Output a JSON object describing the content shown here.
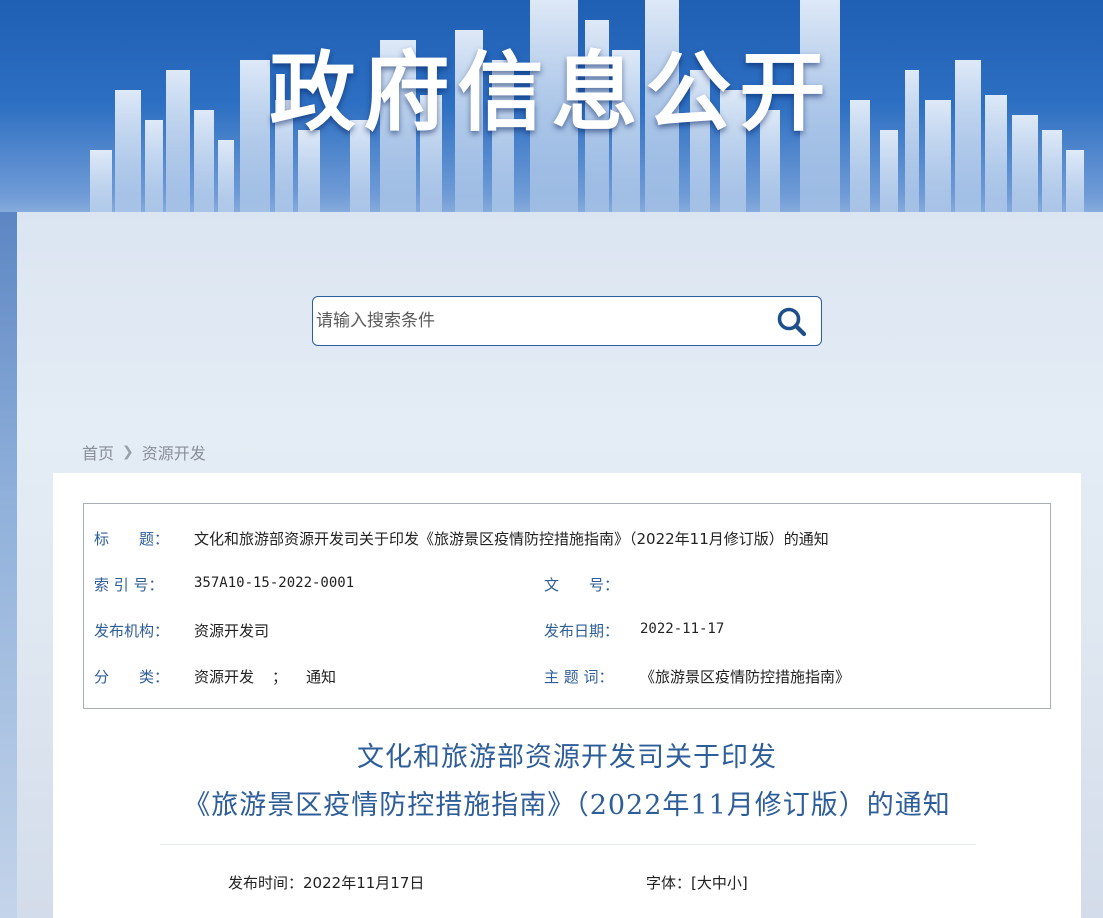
{
  "banner": {
    "title": "政府信息公开"
  },
  "search": {
    "placeholder": "请输入搜索条件",
    "button_icon": "search-icon"
  },
  "breadcrumb": {
    "home": "首页",
    "current": "资源开发"
  },
  "meta": {
    "title_label": "标　　题：",
    "title_value": "文化和旅游部资源开发司关于印发《旅游景区疫情防控措施指南》（2022年11月修订版）的通知",
    "index_label": "索 引 号：",
    "index_value": "357A10-15-2022-0001",
    "doc_no_label": "文　　号：",
    "doc_no_value": "",
    "publisher_label": "发布机构：",
    "publisher_value": "资源开发司",
    "pub_date_label": "发布日期：",
    "pub_date_value": "2022-11-17",
    "category_label": "分　　类：",
    "category_value_1": "资源开发",
    "category_sep": "；",
    "category_value_2": "通知",
    "keywords_label": "主 题 词：",
    "keywords_value": "《旅游景区疫情防控措施指南》"
  },
  "article": {
    "title_line1": "文化和旅游部资源开发司关于印发",
    "title_line2": "《旅游景区疫情防控措施指南》（2022年11月修订版）的通知",
    "pub_time_label": "发布时间：",
    "pub_time_value": "2022年11月17日",
    "font_label": "字体：",
    "font_open": "[",
    "font_large": "大",
    "font_medium": "中",
    "font_small": "小",
    "font_close": "]"
  },
  "colors": {
    "accent": "#2e5e99",
    "banner": "#1f5fb4"
  }
}
